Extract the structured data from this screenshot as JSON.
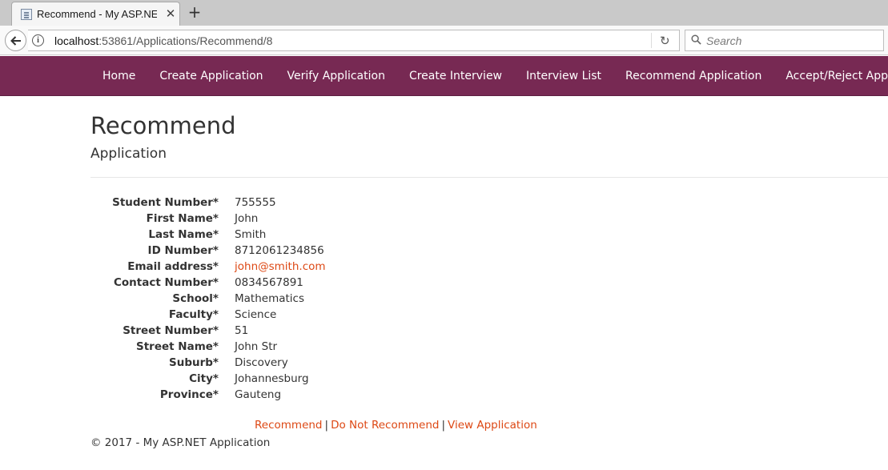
{
  "browser": {
    "tab_title": "Recommend - My ASP.NET",
    "url_host": "localhost",
    "url_rest": ":53861/Applications/Recommend/8",
    "search_placeholder": "Search"
  },
  "nav": {
    "items": [
      {
        "label": "Home"
      },
      {
        "label": "Create Application"
      },
      {
        "label": "Verify Application"
      },
      {
        "label": "Create Interview"
      },
      {
        "label": "Interview List"
      },
      {
        "label": "Recommend Application"
      },
      {
        "label": "Accept/Reject Application"
      }
    ]
  },
  "page": {
    "title": "Recommend",
    "subtitle": "Application"
  },
  "details": [
    {
      "label": "Student Number*",
      "value": "755555"
    },
    {
      "label": "First Name*",
      "value": "John"
    },
    {
      "label": "Last Name*",
      "value": "Smith"
    },
    {
      "label": "ID Number*",
      "value": "8712061234856"
    },
    {
      "label": "Email address*",
      "value": "john@smith.com"
    },
    {
      "label": "Contact Number*",
      "value": "0834567891"
    },
    {
      "label": "School*",
      "value": "Mathematics"
    },
    {
      "label": "Faculty*",
      "value": "Science"
    },
    {
      "label": "Street Number*",
      "value": "51"
    },
    {
      "label": "Street Name*",
      "value": "John Str"
    },
    {
      "label": "Suburb*",
      "value": "Discovery"
    },
    {
      "label": "City*",
      "value": "Johannesburg"
    },
    {
      "label": "Province*",
      "value": "Gauteng"
    }
  ],
  "actions": {
    "recommend": "Recommend",
    "separator": "|",
    "do_not_recommend": "Do Not Recommend",
    "view_application": "View Application"
  },
  "footer": {
    "text": "© 2017 - My ASP.NET Application"
  },
  "colors": {
    "navbar": "#772953",
    "link": "#dd4814",
    "text": "#333333"
  }
}
